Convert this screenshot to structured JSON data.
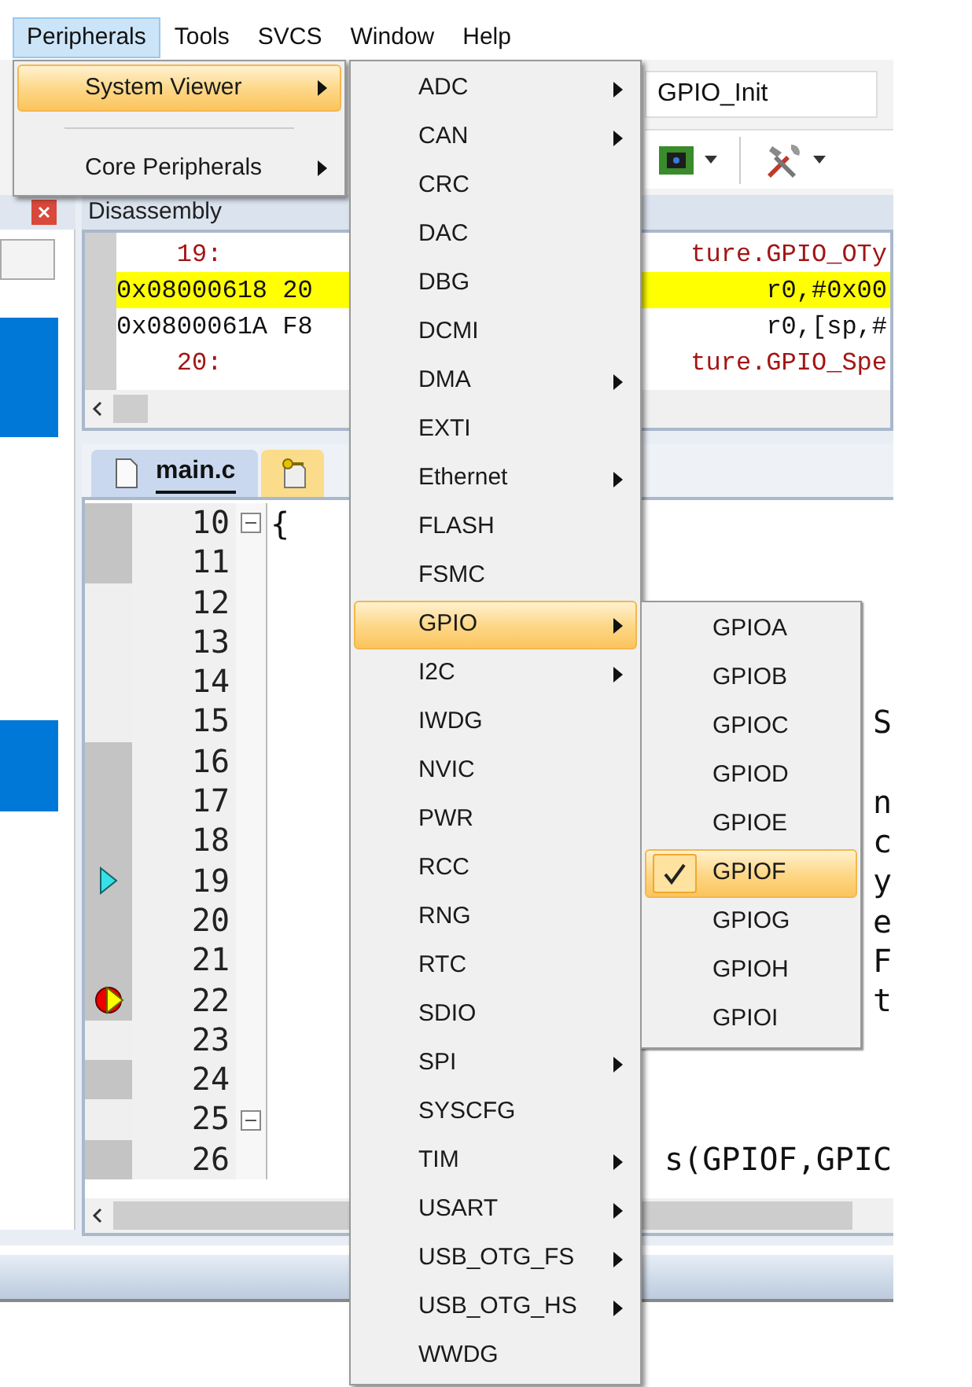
{
  "menubar": [
    {
      "label": "Peripherals",
      "selected": true
    },
    {
      "label": "Tools",
      "selected": false
    },
    {
      "label": "SVCS",
      "selected": false
    },
    {
      "label": "Window",
      "selected": false
    },
    {
      "label": "Help",
      "selected": false
    }
  ],
  "toolbar": {
    "function_box": "GPIO_Init"
  },
  "disassembly": {
    "title": "Disassembly",
    "lines": [
      {
        "kind": "source",
        "left": "    19:",
        "right": "ture.GPIO_OTy",
        "highlighted": false
      },
      {
        "kind": "asm",
        "left": "0x08000618 20",
        "right": "r0,#0x00",
        "highlighted": true
      },
      {
        "kind": "asm",
        "left": "0x0800061A F8",
        "right": "r0,[sp,#",
        "highlighted": false
      },
      {
        "kind": "source",
        "left": "    20:",
        "right": "ture.GPIO_Spe",
        "highlighted": false
      }
    ]
  },
  "editor": {
    "tabs": [
      {
        "label": "main.c",
        "selected": true
      }
    ],
    "lines": [
      {
        "number": "10",
        "code": "{",
        "fold": true,
        "executable": true,
        "current": false,
        "breakpoint": false
      },
      {
        "number": "11",
        "executable": true,
        "fold": false,
        "current": false,
        "breakpoint": false
      },
      {
        "number": "12",
        "executable": false,
        "fold": false,
        "current": false,
        "breakpoint": false
      },
      {
        "number": "13",
        "executable": false,
        "fold": false,
        "current": false,
        "breakpoint": false
      },
      {
        "number": "14",
        "executable": false,
        "fold": false,
        "current": false,
        "breakpoint": false
      },
      {
        "number": "15",
        "executable": false,
        "fold": false,
        "current": false,
        "breakpoint": false,
        "right": "S"
      },
      {
        "number": "16",
        "executable": true,
        "fold": false,
        "current": false,
        "breakpoint": false
      },
      {
        "number": "17",
        "executable": true,
        "fold": false,
        "current": false,
        "breakpoint": false,
        "right": "n"
      },
      {
        "number": "18",
        "executable": true,
        "fold": false,
        "current": false,
        "breakpoint": false,
        "right": "c"
      },
      {
        "number": "19",
        "executable": true,
        "fold": false,
        "current": true,
        "breakpoint": false,
        "right": "y"
      },
      {
        "number": "20",
        "executable": true,
        "fold": false,
        "current": false,
        "breakpoint": false,
        "right": "e"
      },
      {
        "number": "21",
        "executable": true,
        "fold": false,
        "current": false,
        "breakpoint": false,
        "right": "F"
      },
      {
        "number": "22",
        "executable": true,
        "fold": false,
        "current": true,
        "breakpoint": true,
        "right": "t"
      },
      {
        "number": "23",
        "executable": false,
        "fold": false,
        "current": false,
        "breakpoint": false
      },
      {
        "number": "24",
        "executable": true,
        "fold": false,
        "current": false,
        "breakpoint": false
      },
      {
        "number": "25",
        "executable": false,
        "fold": true,
        "current": false,
        "breakpoint": false
      },
      {
        "number": "26",
        "executable": true,
        "fold": false,
        "current": false,
        "breakpoint": false,
        "right": "s(GPIOF,GPIC"
      }
    ]
  },
  "peripherals_menu": [
    {
      "label": "System Viewer",
      "selected": true,
      "submenu": true
    },
    {
      "label": "Core Peripherals",
      "selected": false,
      "submenu": true
    }
  ],
  "system_viewer_menu": [
    {
      "label": "ADC",
      "selected": false,
      "submenu": true
    },
    {
      "label": "CAN",
      "selected": false,
      "submenu": true
    },
    {
      "label": "CRC",
      "selected": false,
      "submenu": false
    },
    {
      "label": "DAC",
      "selected": false,
      "submenu": false
    },
    {
      "label": "DBG",
      "selected": false,
      "submenu": false
    },
    {
      "label": "DCMI",
      "selected": false,
      "submenu": false
    },
    {
      "label": "DMA",
      "selected": false,
      "submenu": true
    },
    {
      "label": "EXTI",
      "selected": false,
      "submenu": false
    },
    {
      "label": "Ethernet",
      "selected": false,
      "submenu": true
    },
    {
      "label": "FLASH",
      "selected": false,
      "submenu": false
    },
    {
      "label": "FSMC",
      "selected": false,
      "submenu": false
    },
    {
      "label": "GPIO",
      "selected": true,
      "submenu": true
    },
    {
      "label": "I2C",
      "selected": false,
      "submenu": true
    },
    {
      "label": "IWDG",
      "selected": false,
      "submenu": false
    },
    {
      "label": "NVIC",
      "selected": false,
      "submenu": false
    },
    {
      "label": "PWR",
      "selected": false,
      "submenu": false
    },
    {
      "label": "RCC",
      "selected": false,
      "submenu": false
    },
    {
      "label": "RNG",
      "selected": false,
      "submenu": false
    },
    {
      "label": "RTC",
      "selected": false,
      "submenu": false
    },
    {
      "label": "SDIO",
      "selected": false,
      "submenu": false
    },
    {
      "label": "SPI",
      "selected": false,
      "submenu": true
    },
    {
      "label": "SYSCFG",
      "selected": false,
      "submenu": false
    },
    {
      "label": "TIM",
      "selected": false,
      "submenu": true
    },
    {
      "label": "USART",
      "selected": false,
      "submenu": true
    },
    {
      "label": "USB_OTG_FS",
      "selected": false,
      "submenu": true
    },
    {
      "label": "USB_OTG_HS",
      "selected": false,
      "submenu": true
    },
    {
      "label": "WWDG",
      "selected": false,
      "submenu": false
    }
  ],
  "gpio_menu": [
    {
      "label": "GPIOA",
      "selected": false,
      "checked": false
    },
    {
      "label": "GPIOB",
      "selected": false,
      "checked": false
    },
    {
      "label": "GPIOC",
      "selected": false,
      "checked": false
    },
    {
      "label": "GPIOD",
      "selected": false,
      "checked": false
    },
    {
      "label": "GPIOE",
      "selected": false,
      "checked": false
    },
    {
      "label": "GPIOF",
      "selected": true,
      "checked": true
    },
    {
      "label": "GPIOG",
      "selected": false,
      "checked": false
    },
    {
      "label": "GPIOH",
      "selected": false,
      "checked": false
    },
    {
      "label": "GPIOI",
      "selected": false,
      "checked": false
    }
  ]
}
